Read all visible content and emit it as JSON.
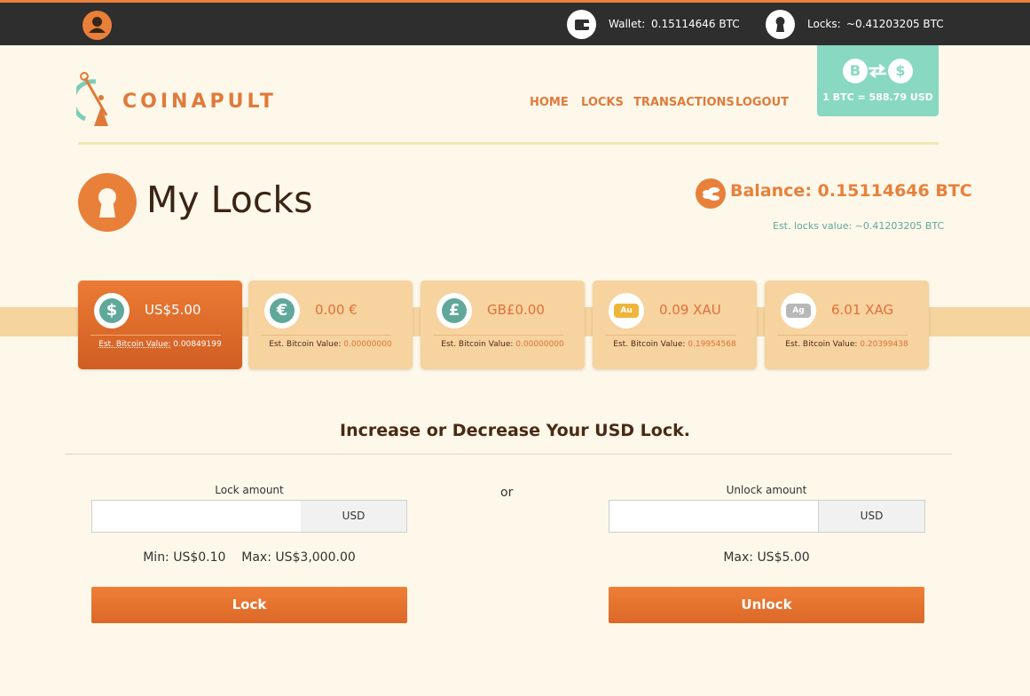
{
  "topbar": {
    "wallet_label": "Wallet:",
    "wallet_value": "0.15114646 BTC",
    "locks_label": "Locks:",
    "locks_value": "~0.41203205 BTC"
  },
  "header": {
    "logo_text": "COINAPULT",
    "nav": [
      "HOME",
      "LOCKS",
      "TRANSACTIONS",
      "LOGOUT"
    ],
    "rate": "1 BTC = 588.79 USD"
  },
  "page": {
    "title": "My Locks",
    "balance": "Balance: 0.15114646 BTC",
    "est_locks": "Est. locks value: ~0.41203205 BTC"
  },
  "locks": [
    {
      "amount": "US$5.00",
      "symbol": "$",
      "est_label": "Est. Bitcoin Value:",
      "est_value": "0.00849199",
      "active": true
    },
    {
      "amount": "0.00 €",
      "symbol": "€",
      "est_label": "Est. Bitcoin Value:",
      "est_value": "0.00000000",
      "active": false
    },
    {
      "amount": "GB£0.00",
      "symbol": "£",
      "est_label": "Est. Bitcoin Value:",
      "est_value": "0.00000000",
      "active": false
    },
    {
      "amount": "0.09 XAU",
      "symbol": "Au",
      "est_label": "Est. Bitcoin Value:",
      "est_value": "0.19954568",
      "active": false
    },
    {
      "amount": "6.01 XAG",
      "symbol": "Ag",
      "est_label": "Est. Bitcoin Value:",
      "est_value": "0.20399438",
      "active": false
    }
  ],
  "form": {
    "title": "Increase or Decrease Your USD Lock.",
    "or": "or",
    "lock": {
      "label": "Lock amount",
      "unit": "USD",
      "min": "Min: US$0.10",
      "max": "Max: US$3,000.00",
      "button": "Lock",
      "value": ""
    },
    "unlock": {
      "label": "Unlock amount",
      "unit": "USD",
      "max": "Max: US$5.00",
      "button": "Unlock",
      "value": ""
    }
  },
  "colors": {
    "accent": "#e8803a",
    "teal": "#88d8c2",
    "background": "#fdf8ea",
    "topbar": "#2e2e2e"
  }
}
